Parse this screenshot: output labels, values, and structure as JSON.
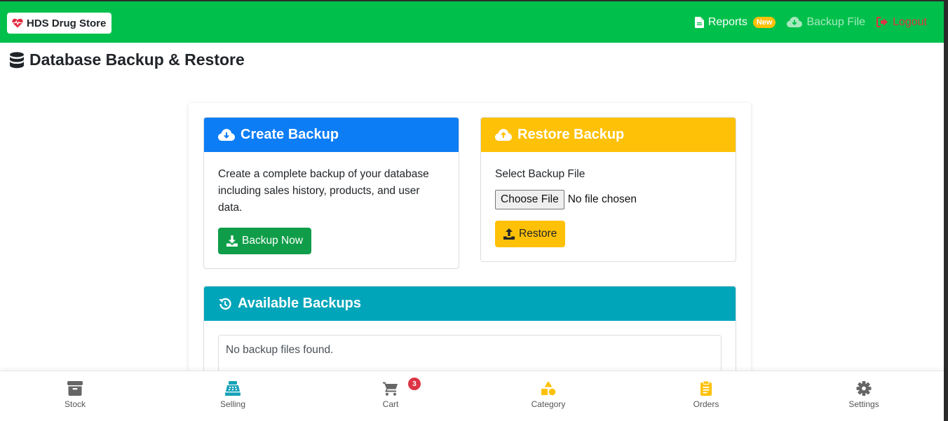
{
  "navbar": {
    "brand": "HDS Drug Store",
    "reports_label": "Reports",
    "reports_badge": "New",
    "backup_label": "Backup File",
    "logout_label": "Logout",
    "color": "#00c04b"
  },
  "page": {
    "title": "Database Backup & Restore"
  },
  "create_backup": {
    "title": "Create Backup",
    "description": "Create a complete backup of your database including sales history, products, and user data.",
    "button_label": "Backup Now",
    "header_color": "#0d7df5"
  },
  "restore_backup": {
    "title": "Restore Backup",
    "file_label": "Select Backup File",
    "choose_file_label": "Choose File",
    "file_status": "No file chosen",
    "button_label": "Restore",
    "header_color": "#ffc107"
  },
  "available_backups": {
    "title": "Available Backups",
    "empty_message": "No backup files found.",
    "header_color": "#00a5ba"
  },
  "bottom_nav": {
    "stock": "Stock",
    "selling": "Selling",
    "cart": "Cart",
    "cart_count": "3",
    "category": "Category",
    "orders": "Orders",
    "settings": "Settings"
  }
}
